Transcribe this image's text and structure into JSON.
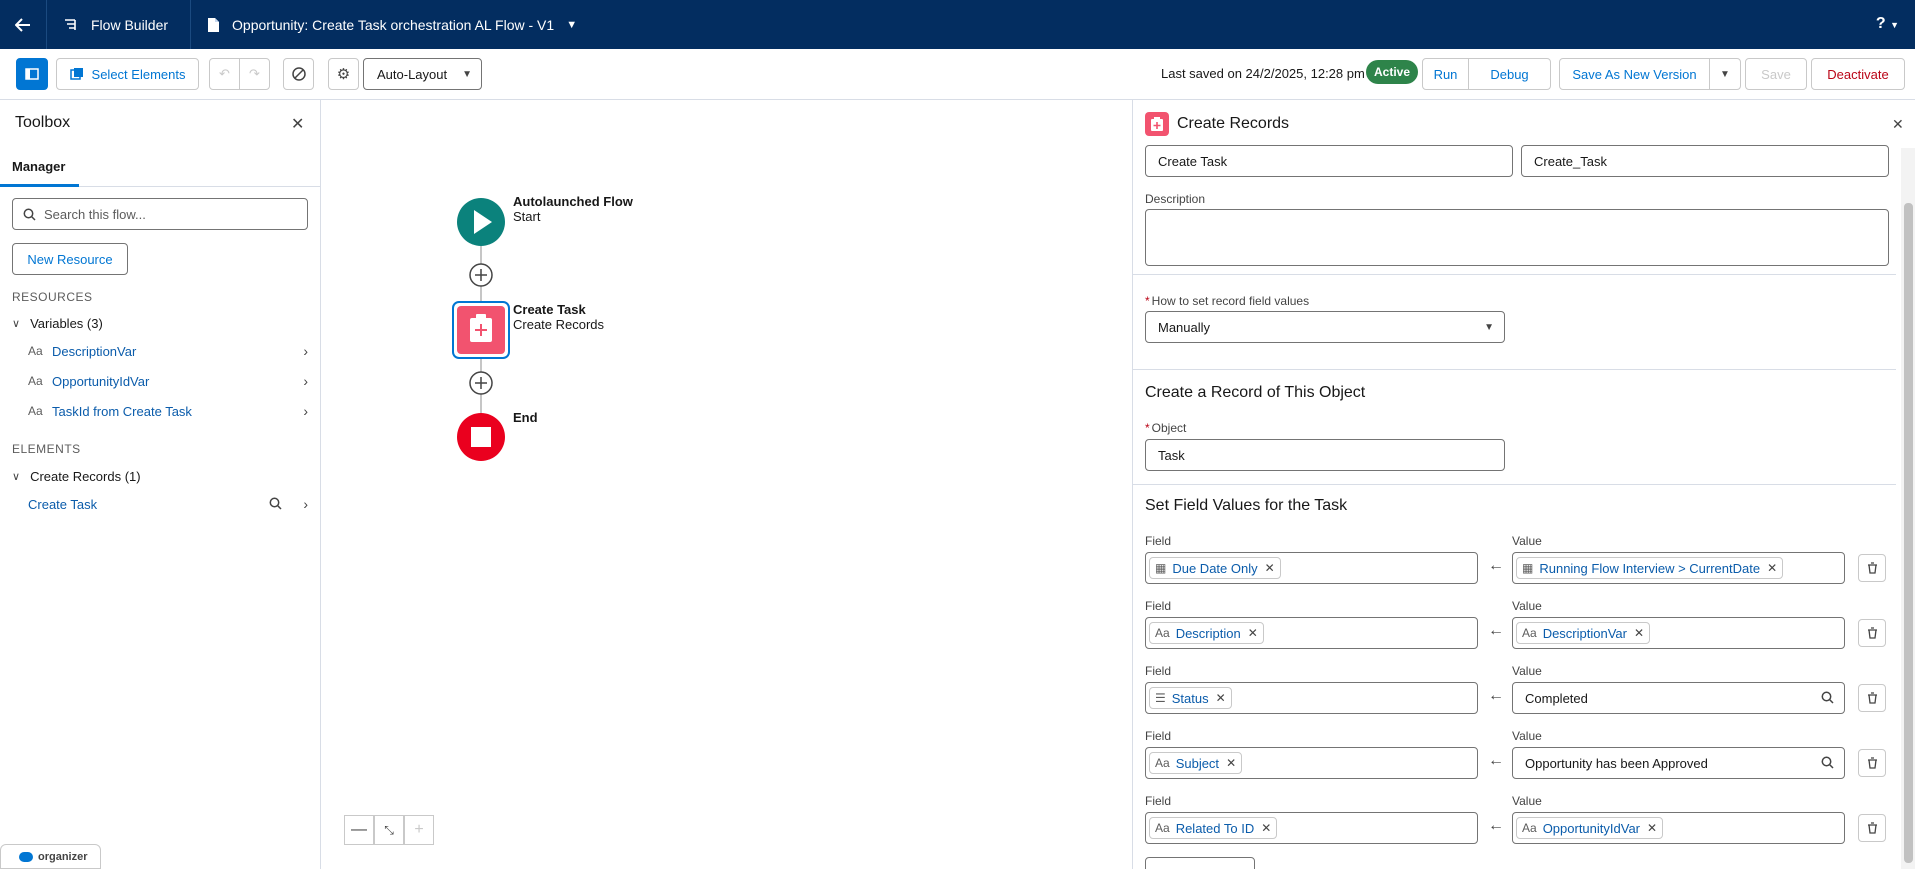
{
  "topbar": {
    "app_name": "Flow Builder",
    "flow_title": "Opportunity: Create Task orchestration AL Flow - V1",
    "help_label": "?"
  },
  "toolbar": {
    "select_elements_label": "Select Elements",
    "layout_value": "Auto-Layout",
    "last_saved": "Last saved on 24/2/2025, 12:28 pm",
    "status_badge": "Active",
    "run_label": "Run",
    "debug_label": "Debug",
    "save_as_new_label": "Save As New Version",
    "save_label": "Save",
    "deactivate_label": "Deactivate"
  },
  "toolbox": {
    "title": "Toolbox",
    "tab_manager": "Manager",
    "search_placeholder": "Search this flow...",
    "new_resource_label": "New Resource",
    "resources_heading": "RESOURCES",
    "variables_group": "Variables (3)",
    "variables": [
      {
        "label": "DescriptionVar"
      },
      {
        "label": "OpportunityIdVar"
      },
      {
        "label": "TaskId from Create Task"
      }
    ],
    "elements_heading": "ELEMENTS",
    "elements_group": "Create Records (1)",
    "elements": [
      {
        "label": "Create Task"
      }
    ]
  },
  "canvas": {
    "start_title": "Autolaunched Flow",
    "start_sub": "Start",
    "task_title": "Create Task",
    "task_sub": "Create Records",
    "end_title": "End",
    "colors": {
      "start": "#0b827c",
      "task": "#f2536f",
      "end": "#ea001e"
    }
  },
  "organizer_label": "organizer",
  "panel": {
    "title": "Create Records",
    "label_value": "Create Task",
    "api_name_value": "Create_Task",
    "description_label": "Description",
    "how_to_label": "How to set record field values",
    "how_to_value": "Manually",
    "create_section_title": "Create a Record of This Object",
    "object_label": "Object",
    "object_value": "Task",
    "set_fields_title": "Set Field Values for the Task",
    "field_label": "Field",
    "value_label": "Value",
    "rows": [
      {
        "field": "Due Date Only",
        "field_icon": "calendar-icon",
        "value": "Running Flow Interview > CurrentDate",
        "value_type": "pill",
        "value_icon": "calendar-icon"
      },
      {
        "field": "Description",
        "field_icon": "text-icon",
        "value": "DescriptionVar",
        "value_type": "pill",
        "value_icon": "text-icon"
      },
      {
        "field": "Status",
        "field_icon": "picklist-icon",
        "value": "Completed",
        "value_type": "text"
      },
      {
        "field": "Subject",
        "field_icon": "text-icon",
        "value": "Opportunity has been Approved",
        "value_type": "text"
      },
      {
        "field": "Related To ID",
        "field_icon": "text-icon",
        "value": "OpportunityIdVar",
        "value_type": "pill",
        "value_icon": "text-icon"
      }
    ]
  }
}
